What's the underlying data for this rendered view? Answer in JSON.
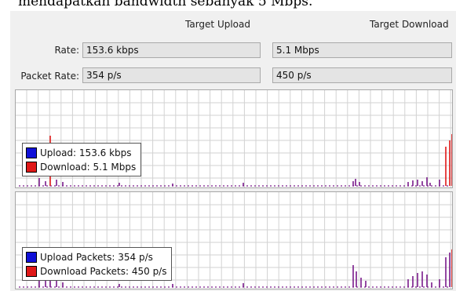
{
  "caption": "mendapatkan bandwidth sebanyak 5 Mbps.",
  "headers": {
    "upload": "Target Upload",
    "download": "Target Download"
  },
  "rows": {
    "rate": {
      "label": "Rate:",
      "upload": "153.6 kbps",
      "download": "5.1 Mbps"
    },
    "packet_rate": {
      "label": "Packet Rate:",
      "upload": "354 p/s",
      "download": "450 p/s"
    }
  },
  "colors": {
    "upload": "#1010d8",
    "download": "#e01818",
    "overlap": "#7a1a8a",
    "grid": "#d2d2d2"
  },
  "graphs": {
    "traffic": {
      "legend": [
        {
          "label": "Upload:",
          "value": "153.6 kbps",
          "series": "upload"
        },
        {
          "label": "Download:",
          "value": "5.1 Mbps",
          "series": "download"
        }
      ]
    },
    "packets": {
      "legend": [
        {
          "label": "Upload Packets:",
          "value": "354 p/s",
          "series": "upload"
        },
        {
          "label": "Download Packets:",
          "value": "450 p/s",
          "series": "download"
        }
      ]
    }
  }
}
